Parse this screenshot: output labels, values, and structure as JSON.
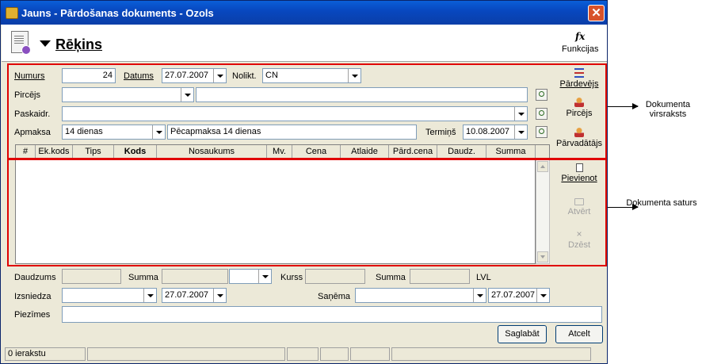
{
  "window": {
    "title": "Jauns - Pārdošanas dokuments - Ozols",
    "close_glyph": "✕"
  },
  "header": {
    "doc_type": "Rēķins",
    "functions_label": "Funkcijas",
    "functions_icon": "fx"
  },
  "form": {
    "numurs": {
      "label": "Numurs",
      "value": "24"
    },
    "datums": {
      "label": "Datums",
      "value": "27.07.2007"
    },
    "nolikt": {
      "label": "Nolikt.",
      "value": "CN"
    },
    "pircejs": {
      "label": "Pircējs",
      "value": "",
      "name": ""
    },
    "paskaidr": {
      "label": "Paskaidr.",
      "value": ""
    },
    "apmaksa": {
      "label": "Apmaksa",
      "value": "14 dienas",
      "description": "Pēcapmaksa 14 dienas"
    },
    "termins": {
      "label": "Termiņš",
      "value": "10.08.2007"
    }
  },
  "side_top": {
    "pardevejs": "Pārdevējs",
    "pircejs": "Pircējs",
    "parvadatajs": "Pārvadātājs"
  },
  "grid": {
    "columns": [
      "#",
      "Ek.kods",
      "Tips",
      "Kods",
      "Nosaukums",
      "Mv.",
      "Cena",
      "Atlaide",
      "Pārd.cena",
      "Daudz.",
      "Summa"
    ]
  },
  "side_bottom": {
    "pievienot": "Pievienot",
    "atvert": "Atvērt",
    "dzest": "Dzēst"
  },
  "totals": {
    "daudzums_label": "Daudzums",
    "summa_label": "Summa",
    "kurss_label": "Kurss",
    "summa2_label": "Summa",
    "currency": "LVL"
  },
  "issue": {
    "izsniedza_label": "Izsniedza",
    "izsniedza_date": "27.07.2007",
    "sanema_label": "Saņēma",
    "sanema_date": "27.07.2007",
    "piezimes_label": "Piezīmes"
  },
  "buttons": {
    "save": "Saglabāt",
    "cancel": "Atcelt"
  },
  "status": {
    "count": "0 ierakstu"
  },
  "annotations": {
    "header_label": "Dokumenta virsraksts",
    "content_label": "Dokumenta saturs"
  },
  "colors": {
    "highlight": "#e00000",
    "titlebar": "#0848c0"
  }
}
